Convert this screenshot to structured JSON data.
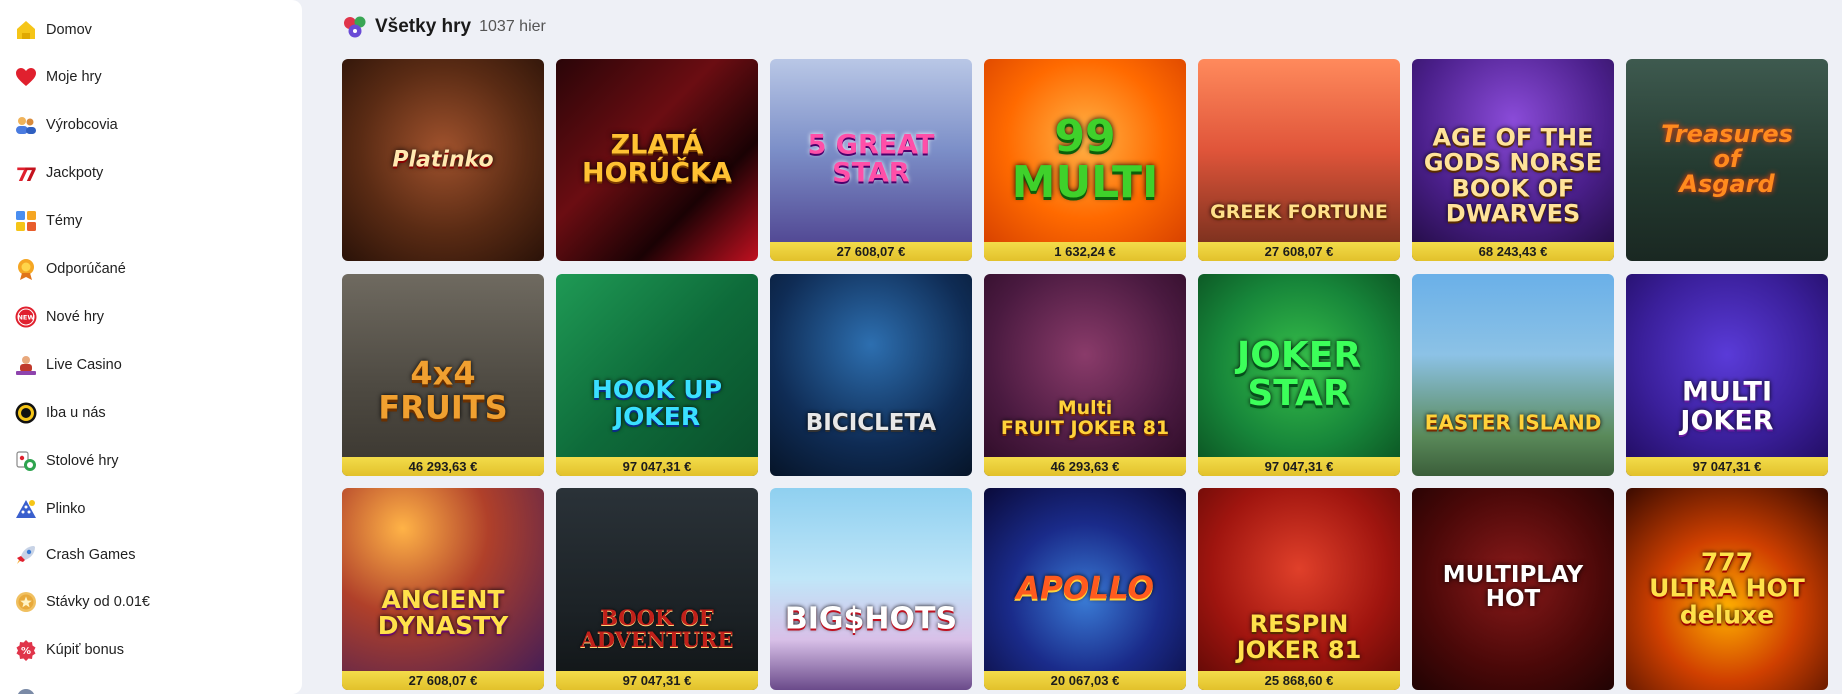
{
  "sidebar": {
    "items": [
      {
        "label": "Domov",
        "icon": "home-icon"
      },
      {
        "label": "Moje hry",
        "icon": "heart-icon"
      },
      {
        "label": "Výrobcovia",
        "icon": "people-icon"
      },
      {
        "label": "Jackpoty",
        "icon": "seven-icon"
      },
      {
        "label": "Témy",
        "icon": "grid-icon"
      },
      {
        "label": "Odporúčané",
        "icon": "badge-icon"
      },
      {
        "label": "Nové hry",
        "icon": "new-icon"
      },
      {
        "label": "Live Casino",
        "icon": "dealer-icon"
      },
      {
        "label": "Iba u nás",
        "icon": "ring-icon"
      },
      {
        "label": "Stolové hry",
        "icon": "cards-icon"
      },
      {
        "label": "Plinko",
        "icon": "plinko-icon"
      },
      {
        "label": "Crash Games",
        "icon": "rocket-icon"
      },
      {
        "label": "Stávky od 0.01€",
        "icon": "coin-icon"
      },
      {
        "label": "Kúpiť bonus",
        "icon": "bonus-icon"
      }
    ]
  },
  "header": {
    "title": "Všetky hry",
    "count": "1037 hier",
    "icon": "dice-icon"
  },
  "games": [
    {
      "title": "Platinko",
      "jackpot": ""
    },
    {
      "title": "ZLATÁ\nHORÚČKA",
      "jackpot": ""
    },
    {
      "title": "5 GREAT\nSTAR",
      "jackpot": "27 608,07  €"
    },
    {
      "title": "99\nMULTI",
      "jackpot": "1 632,24  €"
    },
    {
      "title": "GREEK FORTUNE",
      "jackpot": "27 608,07  €"
    },
    {
      "title": "AGE OF THE GODS NORSE\nBOOK OF\nDWARVES",
      "jackpot": "68 243,43  €"
    },
    {
      "title": "Treasures\nof\nAsgard",
      "jackpot": ""
    },
    {
      "title": "4x4\nFRUITS",
      "jackpot": "46 293,63  €"
    },
    {
      "title": "HOOK UP\nJOKER",
      "jackpot": "97 047,31  €"
    },
    {
      "title": "BICICLETA",
      "jackpot": ""
    },
    {
      "title": "Multi\nFRUIT JOKER 81",
      "jackpot": "46 293,63  €"
    },
    {
      "title": "JOKER\nSTAR",
      "jackpot": "97 047,31  €"
    },
    {
      "title": "EASTER ISLAND",
      "jackpot": ""
    },
    {
      "title": "MULTI\nJOKER",
      "jackpot": "97 047,31  €"
    },
    {
      "title": "ANCIENT\nDYNASTY",
      "jackpot": "27 608,07  €"
    },
    {
      "title": "BOOK OF\nADVENTURE",
      "jackpot": "97 047,31  €"
    },
    {
      "title": "BIG$HOTS",
      "jackpot": ""
    },
    {
      "title": "APOLLO",
      "jackpot": "20 067,03  €"
    },
    {
      "title": "RESPIN\nJOKER 81",
      "jackpot": "25 868,60  €"
    },
    {
      "title": "MULTIPLAY\nHOT",
      "jackpot": ""
    },
    {
      "title": "777\nULTRA HOT deluxe",
      "jackpot": ""
    }
  ]
}
